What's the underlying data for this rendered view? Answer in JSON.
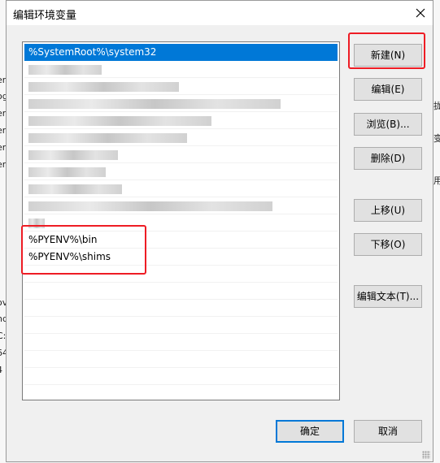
{
  "dialog": {
    "title": "编辑环境变量",
    "close_icon": "close-icon"
  },
  "path_list": {
    "items": [
      {
        "text": "%SystemRoot%\\system32",
        "selected": true
      },
      {
        "text": "%SystemRoot%",
        "obscured": true
      },
      {
        "text": "%SystemRoot%\\System32\\Wbem",
        "obscured": true
      },
      {
        "text": "%SYSTEMROOT%\\System32\\WindowsPowerShell\\v1.0\\",
        "obscured": true
      },
      {
        "text": "%SYSTEMROOT%\\System32\\OpenSSH\\",
        "obscured": true
      },
      {
        "text": "C:\\Program Files\\...\\bin",
        "obscured": true
      },
      {
        "text": "...",
        "obscured": true
      },
      {
        "text": "%JAVA_HOME%\\...",
        "obscured": true
      },
      {
        "text": "%...NK%",
        "obscured": true
      },
      {
        "text": "...\\.dll",
        "obscured": true
      },
      {
        "text": "%...",
        "obscured": true
      },
      {
        "text": "%PYENV%\\bin",
        "selected": false
      },
      {
        "text": "%PYENV%\\shims",
        "selected": false
      }
    ]
  },
  "buttons": {
    "new": "新建(N)",
    "edit": "编辑(E)",
    "browse": "浏览(B)...",
    "delete": "删除(D)",
    "move_up": "上移(U)",
    "move_down": "下移(O)",
    "edit_text": "编辑文本(T)...",
    "ok": "确定",
    "cancel": "取消"
  },
  "background_fragments": {
    "left": [
      "er",
      "og",
      "er",
      "er",
      "er",
      "er",
      "ov",
      "nd",
      "C:",
      "64",
      "4"
    ],
    "right": [
      "拢",
      "变",
      "用"
    ]
  },
  "colors": {
    "selection": "#0078d7",
    "annotation": "#ee1c24",
    "default_button_border": "#0078d7"
  }
}
